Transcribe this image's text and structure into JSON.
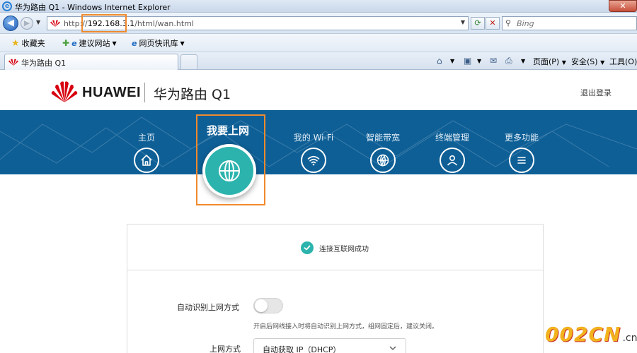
{
  "window": {
    "title": "华为路由 Q1 - Windows Internet Explorer"
  },
  "navbar": {
    "url_prefix": "http://",
    "url_host": "192.168.3.1",
    "url_path": "/html/wan.html",
    "search_placeholder": "Bing"
  },
  "favorites_bar": {
    "favorites_label": "收藏夹",
    "items": [
      {
        "label": "建议网站"
      },
      {
        "label": "网页快讯库"
      }
    ]
  },
  "tabs": [
    {
      "label": "华为路由 Q1"
    }
  ],
  "command_bar": {
    "page_label": "页面(P)",
    "safety_label": "安全(S)",
    "tools_label": "工具(O)"
  },
  "header": {
    "brand": "HUAWEI",
    "product": "华为路由 Q1",
    "logout": "退出登录"
  },
  "menu": {
    "active": {
      "label": "我要上网",
      "icon": "globe-icon"
    },
    "items": [
      {
        "label": "主页",
        "icon": "home-icon"
      },
      {
        "label": "我的 Wi-Fi",
        "icon": "wifi-icon"
      },
      {
        "label": "智能带宽",
        "icon": "bandwidth-globe-icon"
      },
      {
        "label": "终端管理",
        "icon": "user-icon"
      },
      {
        "label": "更多功能",
        "icon": "menu-icon"
      }
    ]
  },
  "content": {
    "status_text": "连接互联网成功",
    "auto_detect_label": "自动识别上网方式",
    "auto_detect_enabled": false,
    "auto_detect_hint": "开启后网线接入时将自动识别上网方式，组网固定后，建议关闭。",
    "mode_label": "上网方式",
    "mode_value": "自动获取 IP（DHCP）"
  },
  "watermark": {
    "main": "002CN",
    "sub": ".cn"
  },
  "colors": {
    "brand_blue": "#0e5f96",
    "accent_teal": "#2cb3ad",
    "highlight_orange": "#f08a2c",
    "huawei_red": "#d7000f"
  }
}
